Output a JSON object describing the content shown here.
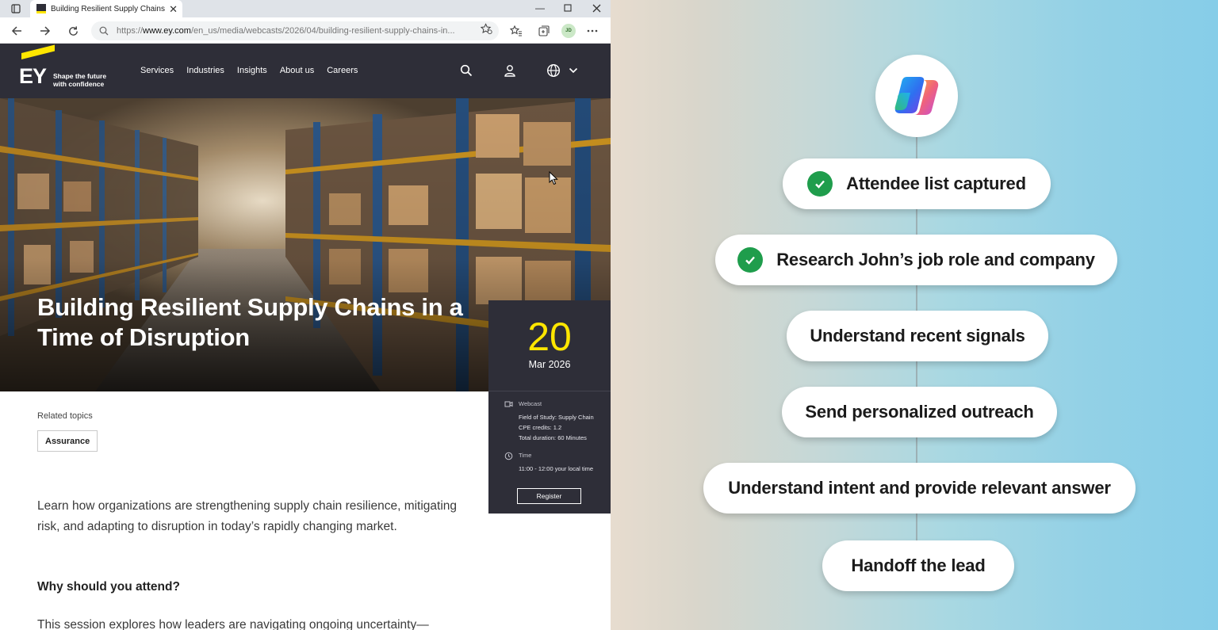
{
  "browser": {
    "tab_title": "Building Resilient Supply Chains i...",
    "url_scheme": "https://",
    "url_host": "www.ey.com",
    "url_path": "/en_us/media/webcasts/2026/04/building-resilient-supply-chains-in...",
    "profile_initials": "JD"
  },
  "ey_header": {
    "logo_text": "EY",
    "tagline": "Shape the future with confidence",
    "nav": [
      "Services",
      "Industries",
      "Insights",
      "About us",
      "Careers"
    ]
  },
  "hero": {
    "title": "Building Resilient Supply Chains in a Time of Disruption"
  },
  "event_card": {
    "day": "20",
    "month_year": "Mar 2026",
    "type_label": "Webcast",
    "field_of_study": "Field of Study: Supply Chain",
    "cpe_credits": "CPE credits: 1.2",
    "duration": "Total duration: 60 Minutes",
    "time_label": "Time",
    "time_value": "11:00 - 12:00 your local time",
    "register_label": "Register"
  },
  "content": {
    "related_label": "Related topics",
    "topic_tag": "Assurance",
    "intro": "Learn how organizations are strengthening supply chain resilience, mitigating risk, and adapting to disruption in today’s rapidly changing market.",
    "why_heading": "Why should you attend?",
    "session_text": "This session explores how leaders are navigating ongoing uncertainty—"
  },
  "workflow": {
    "steps": [
      {
        "label": "Attendee list captured",
        "done": true
      },
      {
        "label": "Research John’s job role and company",
        "done": true
      },
      {
        "label": "Understand recent signals",
        "done": false
      },
      {
        "label": "Send personalized outreach",
        "done": false
      },
      {
        "label": "Understand intent and provide relevant answer",
        "done": false
      },
      {
        "label": "Handoff the lead",
        "done": false
      }
    ],
    "colors": {
      "check": "#1f9d4c",
      "ey_yellow": "#ffe600",
      "ey_dark": "#2e2e38"
    }
  }
}
